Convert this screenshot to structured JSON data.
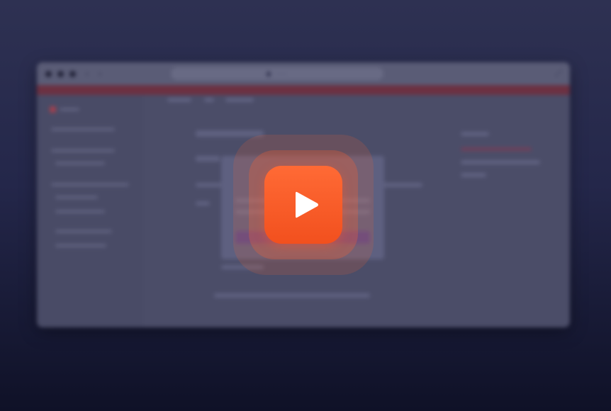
{
  "preview": {
    "url_text": "······",
    "nav_back": "‹",
    "nav_forward": "›",
    "expand_symbol": "⤢"
  },
  "play": {
    "icon": "play-icon",
    "accent_color": "#f2501e"
  },
  "background": {
    "top_color": "#2e3152",
    "bottom_color": "#0f1127"
  }
}
